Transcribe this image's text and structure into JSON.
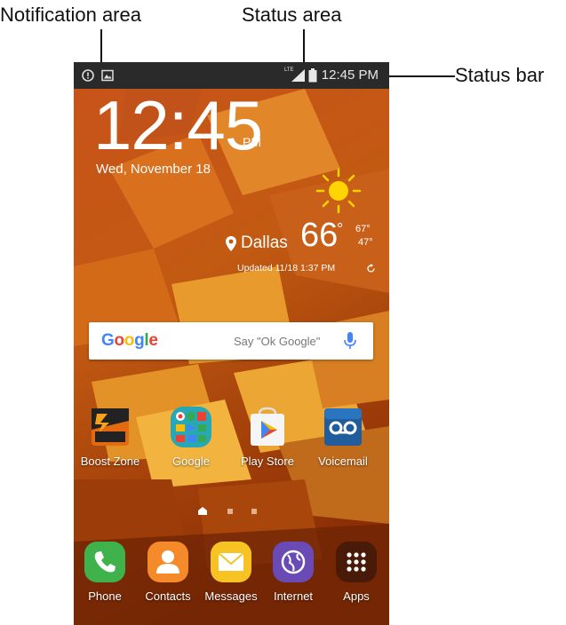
{
  "callouts": {
    "notification_area": "Notification area",
    "status_area": "Status area",
    "status_bar": "Status bar"
  },
  "status_bar": {
    "time": "12:45 PM",
    "network": "LTE"
  },
  "clock_widget": {
    "time": "12:45",
    "ampm": "PM",
    "date": "Wed, November 18"
  },
  "weather": {
    "city": "Dallas",
    "temp": "66",
    "deg": "°",
    "hi": "67°",
    "lo": "47°",
    "updated": "Updated  11/18  1:37 PM",
    "icon": "sun-icon"
  },
  "search": {
    "brand": [
      "G",
      "o",
      "o",
      "g",
      "l",
      "e"
    ],
    "hint": "Say \"Ok Google\""
  },
  "apps": [
    {
      "label": "Boost Zone",
      "icon": "boost-zone-icon"
    },
    {
      "label": "Google",
      "icon": "google-folder-icon"
    },
    {
      "label": "Play Store",
      "icon": "play-store-icon"
    },
    {
      "label": "Voicemail",
      "icon": "voicemail-icon"
    }
  ],
  "dock": [
    {
      "label": "Phone",
      "icon": "phone-icon"
    },
    {
      "label": "Contacts",
      "icon": "contacts-icon"
    },
    {
      "label": "Messages",
      "icon": "messages-icon"
    },
    {
      "label": "Internet",
      "icon": "internet-icon"
    },
    {
      "label": "Apps",
      "icon": "apps-grid-icon"
    }
  ],
  "colors": {
    "status_bar": "#2a2a2a",
    "wallpaper": "#b4430c",
    "google_blue": "#4285f4",
    "google_red": "#ea4335",
    "google_yellow": "#fbbc05",
    "google_green": "#34a853"
  }
}
